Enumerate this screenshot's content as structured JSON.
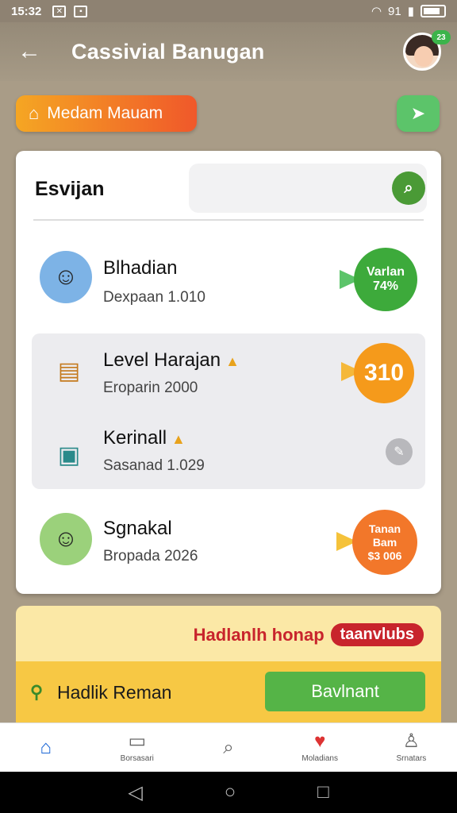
{
  "status_bar": {
    "time": "15:32",
    "signal": "91"
  },
  "header": {
    "title": "Cassivial Banugan",
    "avatar_badge": "23"
  },
  "chip": {
    "label": "Medam Mauam"
  },
  "card": {
    "title": "Esvijan",
    "search": {
      "placeholder": ""
    },
    "items": [
      {
        "name": "Blhadian",
        "sub": "Dexpaan  1.010",
        "badge_line1": "Varlan",
        "badge_line2": "74%",
        "badge_color": "#3daa3b"
      },
      {
        "name": "Level Harajan",
        "sub": "Eroparin  2000",
        "badge_line1": "310",
        "badge_color": "#f59a1b"
      },
      {
        "name": "Kerinall",
        "sub": "Sasanad  1.029"
      },
      {
        "name": "Sgnakal",
        "sub": "Bropada  2026",
        "badge_line1": "Tanan",
        "badge_line2": "Bam",
        "badge_line3": "$3 006",
        "badge_color": "#f2772a"
      }
    ]
  },
  "promo": {
    "headline": "Hadlanlh honap",
    "pill": "taanvlubs",
    "label": "Hadlik Reman",
    "button": "Bavlnant"
  },
  "bottom_nav": [
    {
      "label": "Home",
      "icon": "home-icon"
    },
    {
      "label": "Borsasari",
      "icon": "chat-icon"
    },
    {
      "label": "",
      "icon": "search-icon"
    },
    {
      "label": "Moladians",
      "icon": "heart-chat-icon"
    },
    {
      "label": "Srnatars",
      "icon": "profile-icon"
    }
  ],
  "colors": {
    "accent_green": "#55b447",
    "accent_orange": "#f0582a",
    "nav_active": "#1a66d6"
  }
}
